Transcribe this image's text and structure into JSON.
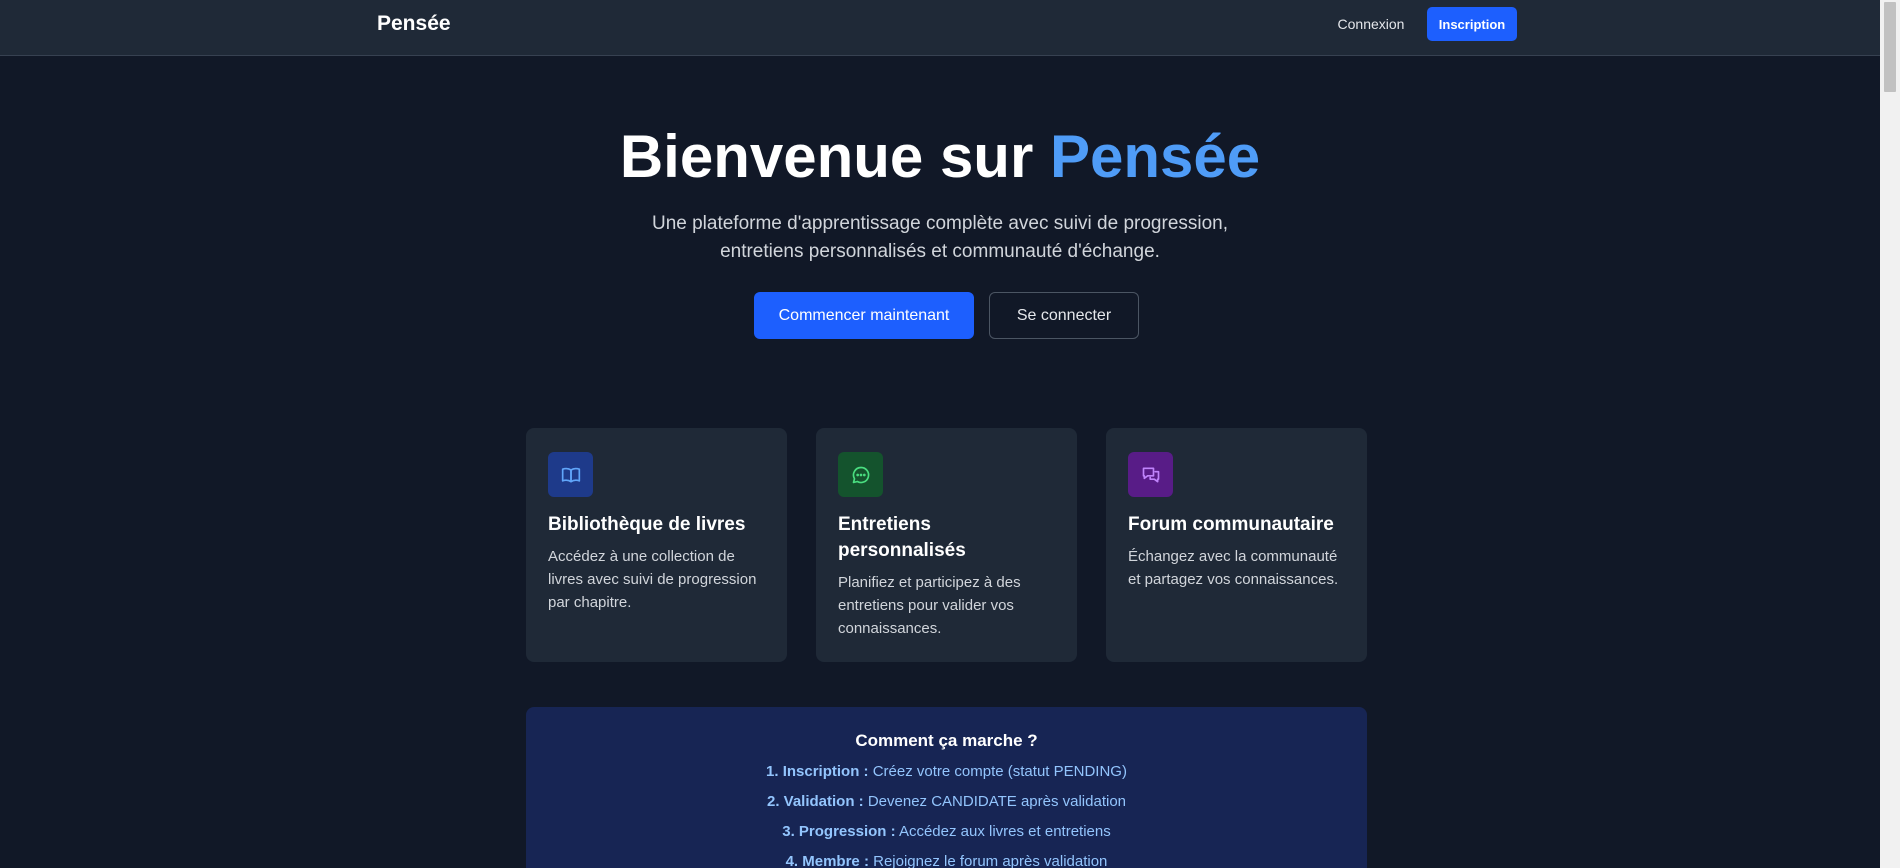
{
  "header": {
    "brand": "Pensée",
    "login_label": "Connexion",
    "signup_label": "Inscription"
  },
  "hero": {
    "title_prefix": "Bienvenue sur ",
    "title_accent": "Pensée",
    "subtitle_line1": "Une plateforme d'apprentissage complète avec suivi de progression,",
    "subtitle_line2": "entretiens personnalisés et communauté d'échange.",
    "primary_label": "Commencer maintenant",
    "secondary_label": "Se connecter"
  },
  "features": [
    {
      "icon": "book-icon",
      "title": "Bibliothèque de livres",
      "text": "Accédez à une collection de livres avec suivi de progression par chapitre."
    },
    {
      "icon": "chat-bubble-icon",
      "title": "Entretiens personnalisés",
      "text": "Planifiez et participez à des entretiens pour valider vos connaissances."
    },
    {
      "icon": "chat-bubbles-icon",
      "title": "Forum communautaire",
      "text": "Échangez avec la communauté et partagez vos connaissances."
    }
  ],
  "how": {
    "title": "Comment ça marche ?",
    "steps": [
      {
        "label": "1. Inscription :",
        "text": " Créez votre compte (statut PENDING)"
      },
      {
        "label": "2. Validation :",
        "text": " Devenez CANDIDATE après validation"
      },
      {
        "label": "3. Progression :",
        "text": " Accédez aux livres et entretiens"
      },
      {
        "label": "4. Membre :",
        "text": " Rejoignez le forum après validation"
      }
    ]
  },
  "colors": {
    "background": "#111827",
    "header": "#1f2937",
    "accent": "#1d5ffe",
    "accent_text": "#4f9cf7",
    "card": "#1f2937",
    "how_panel": "#172554"
  }
}
